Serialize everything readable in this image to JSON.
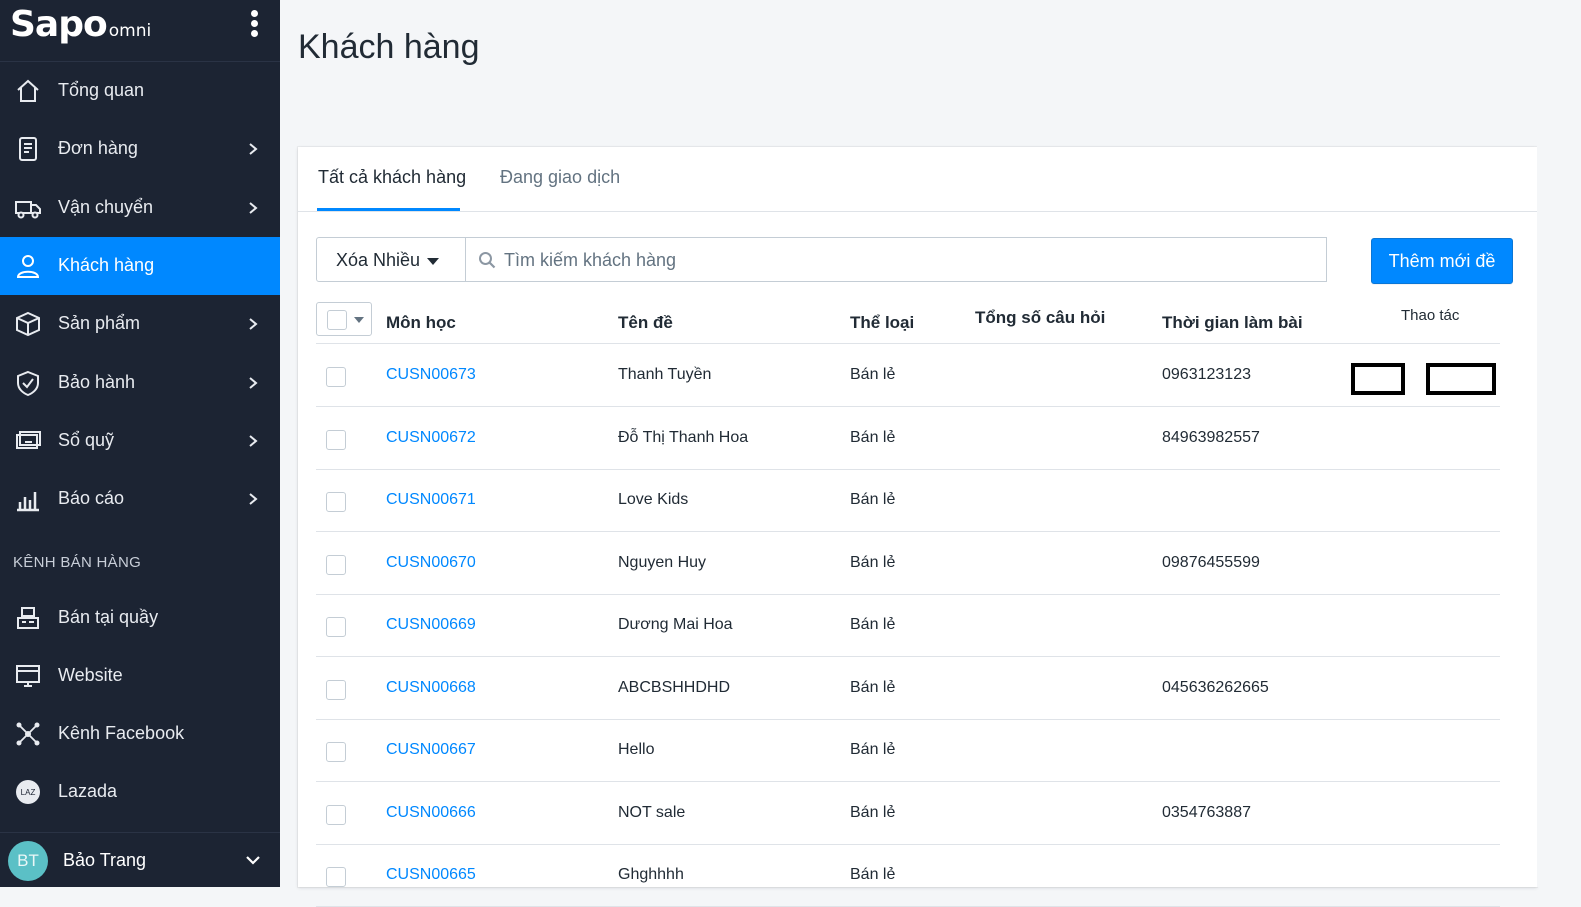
{
  "brand": {
    "name": "Sapo",
    "suffix": "omni"
  },
  "sidebar": {
    "items": [
      {
        "label": "Tổng quan",
        "icon": "home-icon",
        "chevron": false,
        "active": false
      },
      {
        "label": "Đơn hàng",
        "icon": "order-icon",
        "chevron": true,
        "active": false
      },
      {
        "label": "Vận chuyển",
        "icon": "truck-icon",
        "chevron": true,
        "active": false
      },
      {
        "label": "Khách hàng",
        "icon": "user-icon",
        "chevron": false,
        "active": true
      },
      {
        "label": "Sản phẩm",
        "icon": "box-icon",
        "chevron": true,
        "active": false
      },
      {
        "label": "Bảo hành",
        "icon": "shield-icon",
        "chevron": true,
        "active": false
      },
      {
        "label": "Sổ quỹ",
        "icon": "cash-icon",
        "chevron": true,
        "active": false
      },
      {
        "label": "Báo cáo",
        "icon": "chart-icon",
        "chevron": true,
        "active": false
      }
    ],
    "section_title": "KÊNH BÁN HÀNG",
    "channels": [
      {
        "label": "Bán tại quầy",
        "icon": "pos-icon"
      },
      {
        "label": "Website",
        "icon": "website-icon"
      },
      {
        "label": "Kênh Facebook",
        "icon": "network-icon"
      },
      {
        "label": "Lazada",
        "icon": "lazada-icon",
        "icon_text": "LAZ"
      }
    ],
    "user": {
      "initials": "BT",
      "name": "Bảo Trang"
    }
  },
  "page": {
    "title": "Khách hàng"
  },
  "tabs": [
    {
      "label": "Tất cả khách hàng",
      "active": true
    },
    {
      "label": "Đang giao dịch",
      "active": false
    }
  ],
  "toolbar": {
    "bulk_action": "Xóa Nhiều",
    "search_placeholder": "Tìm kiếm khách hàng",
    "add_button": "Thêm mới đề"
  },
  "table": {
    "headers": [
      "Môn học",
      "Tên đề",
      "Thể loại",
      "Tổng số câu hỏi",
      "Thời gian làm bài",
      "Thao tác"
    ],
    "rows": [
      {
        "code": "CUSN00673",
        "name": "Thanh Tuyền",
        "type": "Bán lẻ",
        "total": "",
        "time": "0963123123"
      },
      {
        "code": "CUSN00672",
        "name": "Đỗ Thị Thanh Hoa",
        "type": "Bán lẻ",
        "total": "",
        "time": "84963982557"
      },
      {
        "code": "CUSN00671",
        "name": "Love Kids",
        "type": "Bán lẻ",
        "total": "",
        "time": ""
      },
      {
        "code": "CUSN00670",
        "name": "Nguyen Huy",
        "type": "Bán lẻ",
        "total": "",
        "time": "09876455599"
      },
      {
        "code": "CUSN00669",
        "name": "Dương Mai Hoa",
        "type": "Bán lẻ",
        "total": "",
        "time": ""
      },
      {
        "code": "CUSN00668",
        "name": "ABCBSHHDHD",
        "type": "Bán lẻ",
        "total": "",
        "time": "045636262665"
      },
      {
        "code": "CUSN00667",
        "name": "Hello",
        "type": "Bán lẻ",
        "total": "",
        "time": ""
      },
      {
        "code": "CUSN00666",
        "name": "NOT sale",
        "type": "Bán lẻ",
        "total": "",
        "time": "0354763887"
      },
      {
        "code": "CUSN00665",
        "name": "Ghghhhh",
        "type": "Bán lẻ",
        "total": "",
        "time": ""
      }
    ]
  },
  "colors": {
    "sidebar_bg": "#1c2433",
    "accent": "#0088ff",
    "link": "#0088ff",
    "page_bg": "#f4f6f8"
  }
}
